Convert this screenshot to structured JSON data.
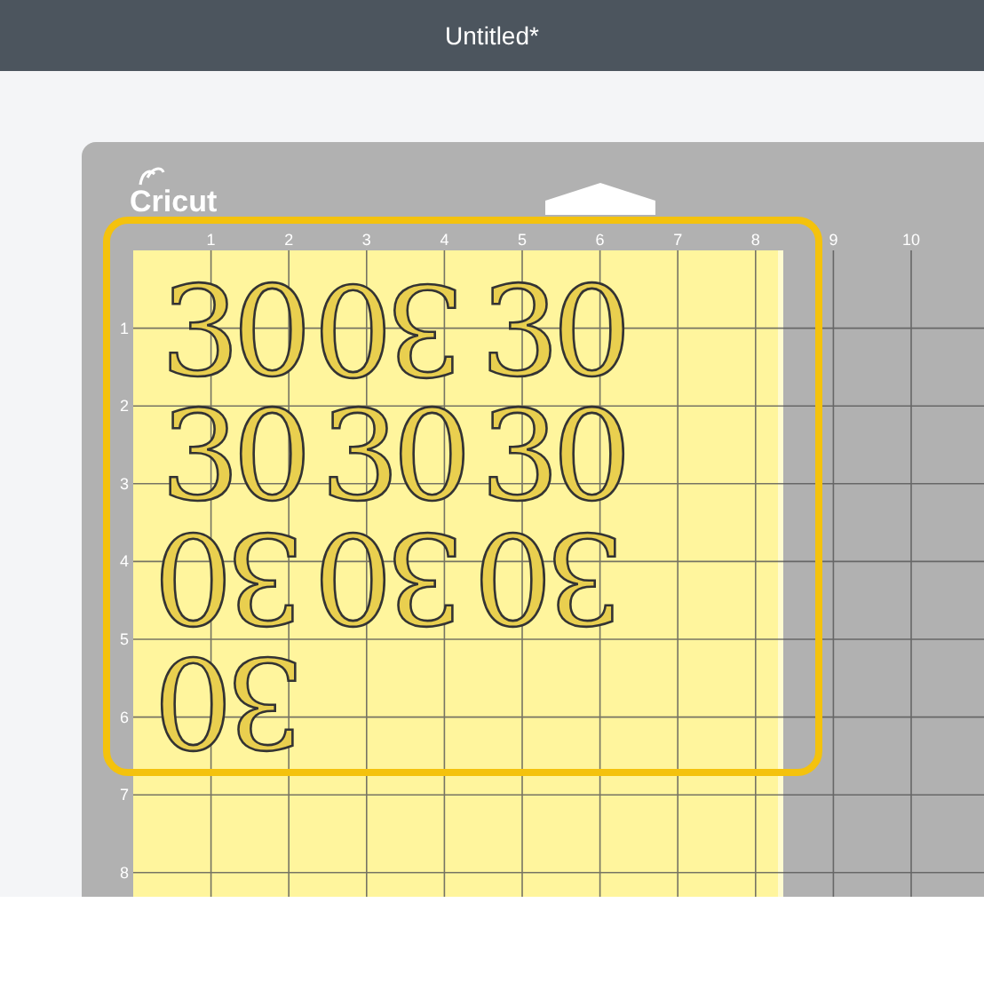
{
  "window": {
    "title": "Untitled*"
  },
  "mat": {
    "logo": "Cricut",
    "top_ruler": [
      "1",
      "2",
      "3",
      "4",
      "5",
      "6",
      "7",
      "8",
      "9",
      "10"
    ],
    "left_ruler": [
      "1",
      "2",
      "3",
      "4",
      "5",
      "6",
      "7",
      "8"
    ],
    "shapes": [
      {
        "text": "30",
        "rotated": false
      },
      {
        "text": "30",
        "rotated": true
      },
      {
        "text": "30",
        "rotated": false
      },
      {
        "text": "30",
        "rotated": false
      },
      {
        "text": "30",
        "rotated": false
      },
      {
        "text": "30",
        "rotated": false
      },
      {
        "text": "30",
        "rotated": true
      },
      {
        "text": "30",
        "rotated": true
      },
      {
        "text": "30",
        "rotated": true
      },
      {
        "text": "30",
        "rotated": true
      }
    ],
    "selected": true
  }
}
